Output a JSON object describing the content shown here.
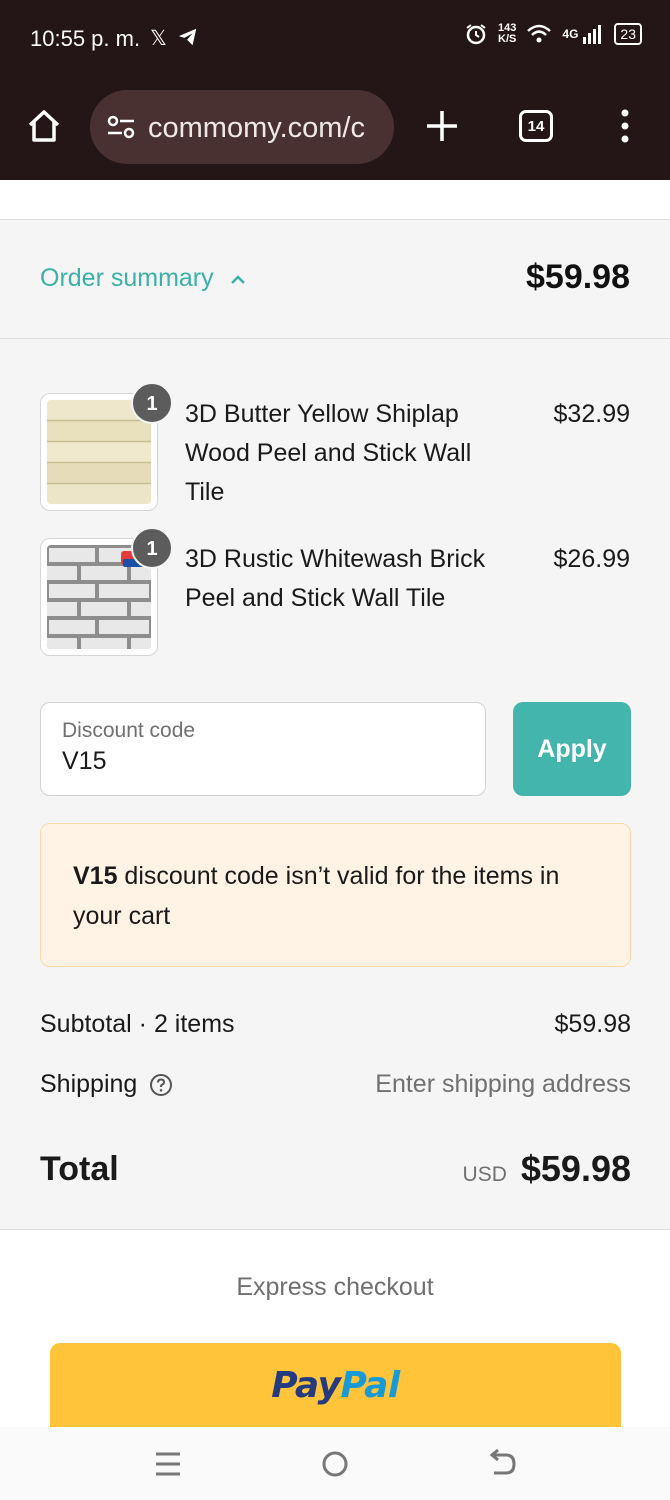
{
  "status_bar": {
    "time": "10:55 p. m.",
    "net_speed_value": "143",
    "net_speed_unit": "K/S",
    "network": "4G",
    "battery": "23"
  },
  "browser": {
    "url": "commomy.com/c",
    "tab_count": "14"
  },
  "order_summary": {
    "toggle_label": "Order summary",
    "total": "$59.98"
  },
  "items": [
    {
      "name": "3D Butter Yellow Shiplap Wood Peel and Stick Wall Tile",
      "price": "$32.99",
      "quantity": "1"
    },
    {
      "name": "3D Rustic Whitewash Brick Peel and Stick Wall Tile",
      "price": "$26.99",
      "quantity": "1"
    }
  ],
  "discount": {
    "label": "Discount code",
    "value": "V15",
    "apply_label": "Apply"
  },
  "error": {
    "code": "V15",
    "message": " discount code isn’t valid for the items in your cart"
  },
  "totals": {
    "subtotal_label": "Subtotal · 2 items",
    "subtotal_value": "$59.98",
    "shipping_label": "Shipping",
    "shipping_value": "Enter shipping address",
    "total_label": "Total",
    "currency": "USD",
    "total_value": "$59.98"
  },
  "express": {
    "label": "Express checkout",
    "paypal_part1": "Pay",
    "paypal_part2": "Pal"
  },
  "colors": {
    "accent": "#43b5ad",
    "paypal_yellow": "#ffc43a",
    "error_bg": "#fff3e6"
  }
}
